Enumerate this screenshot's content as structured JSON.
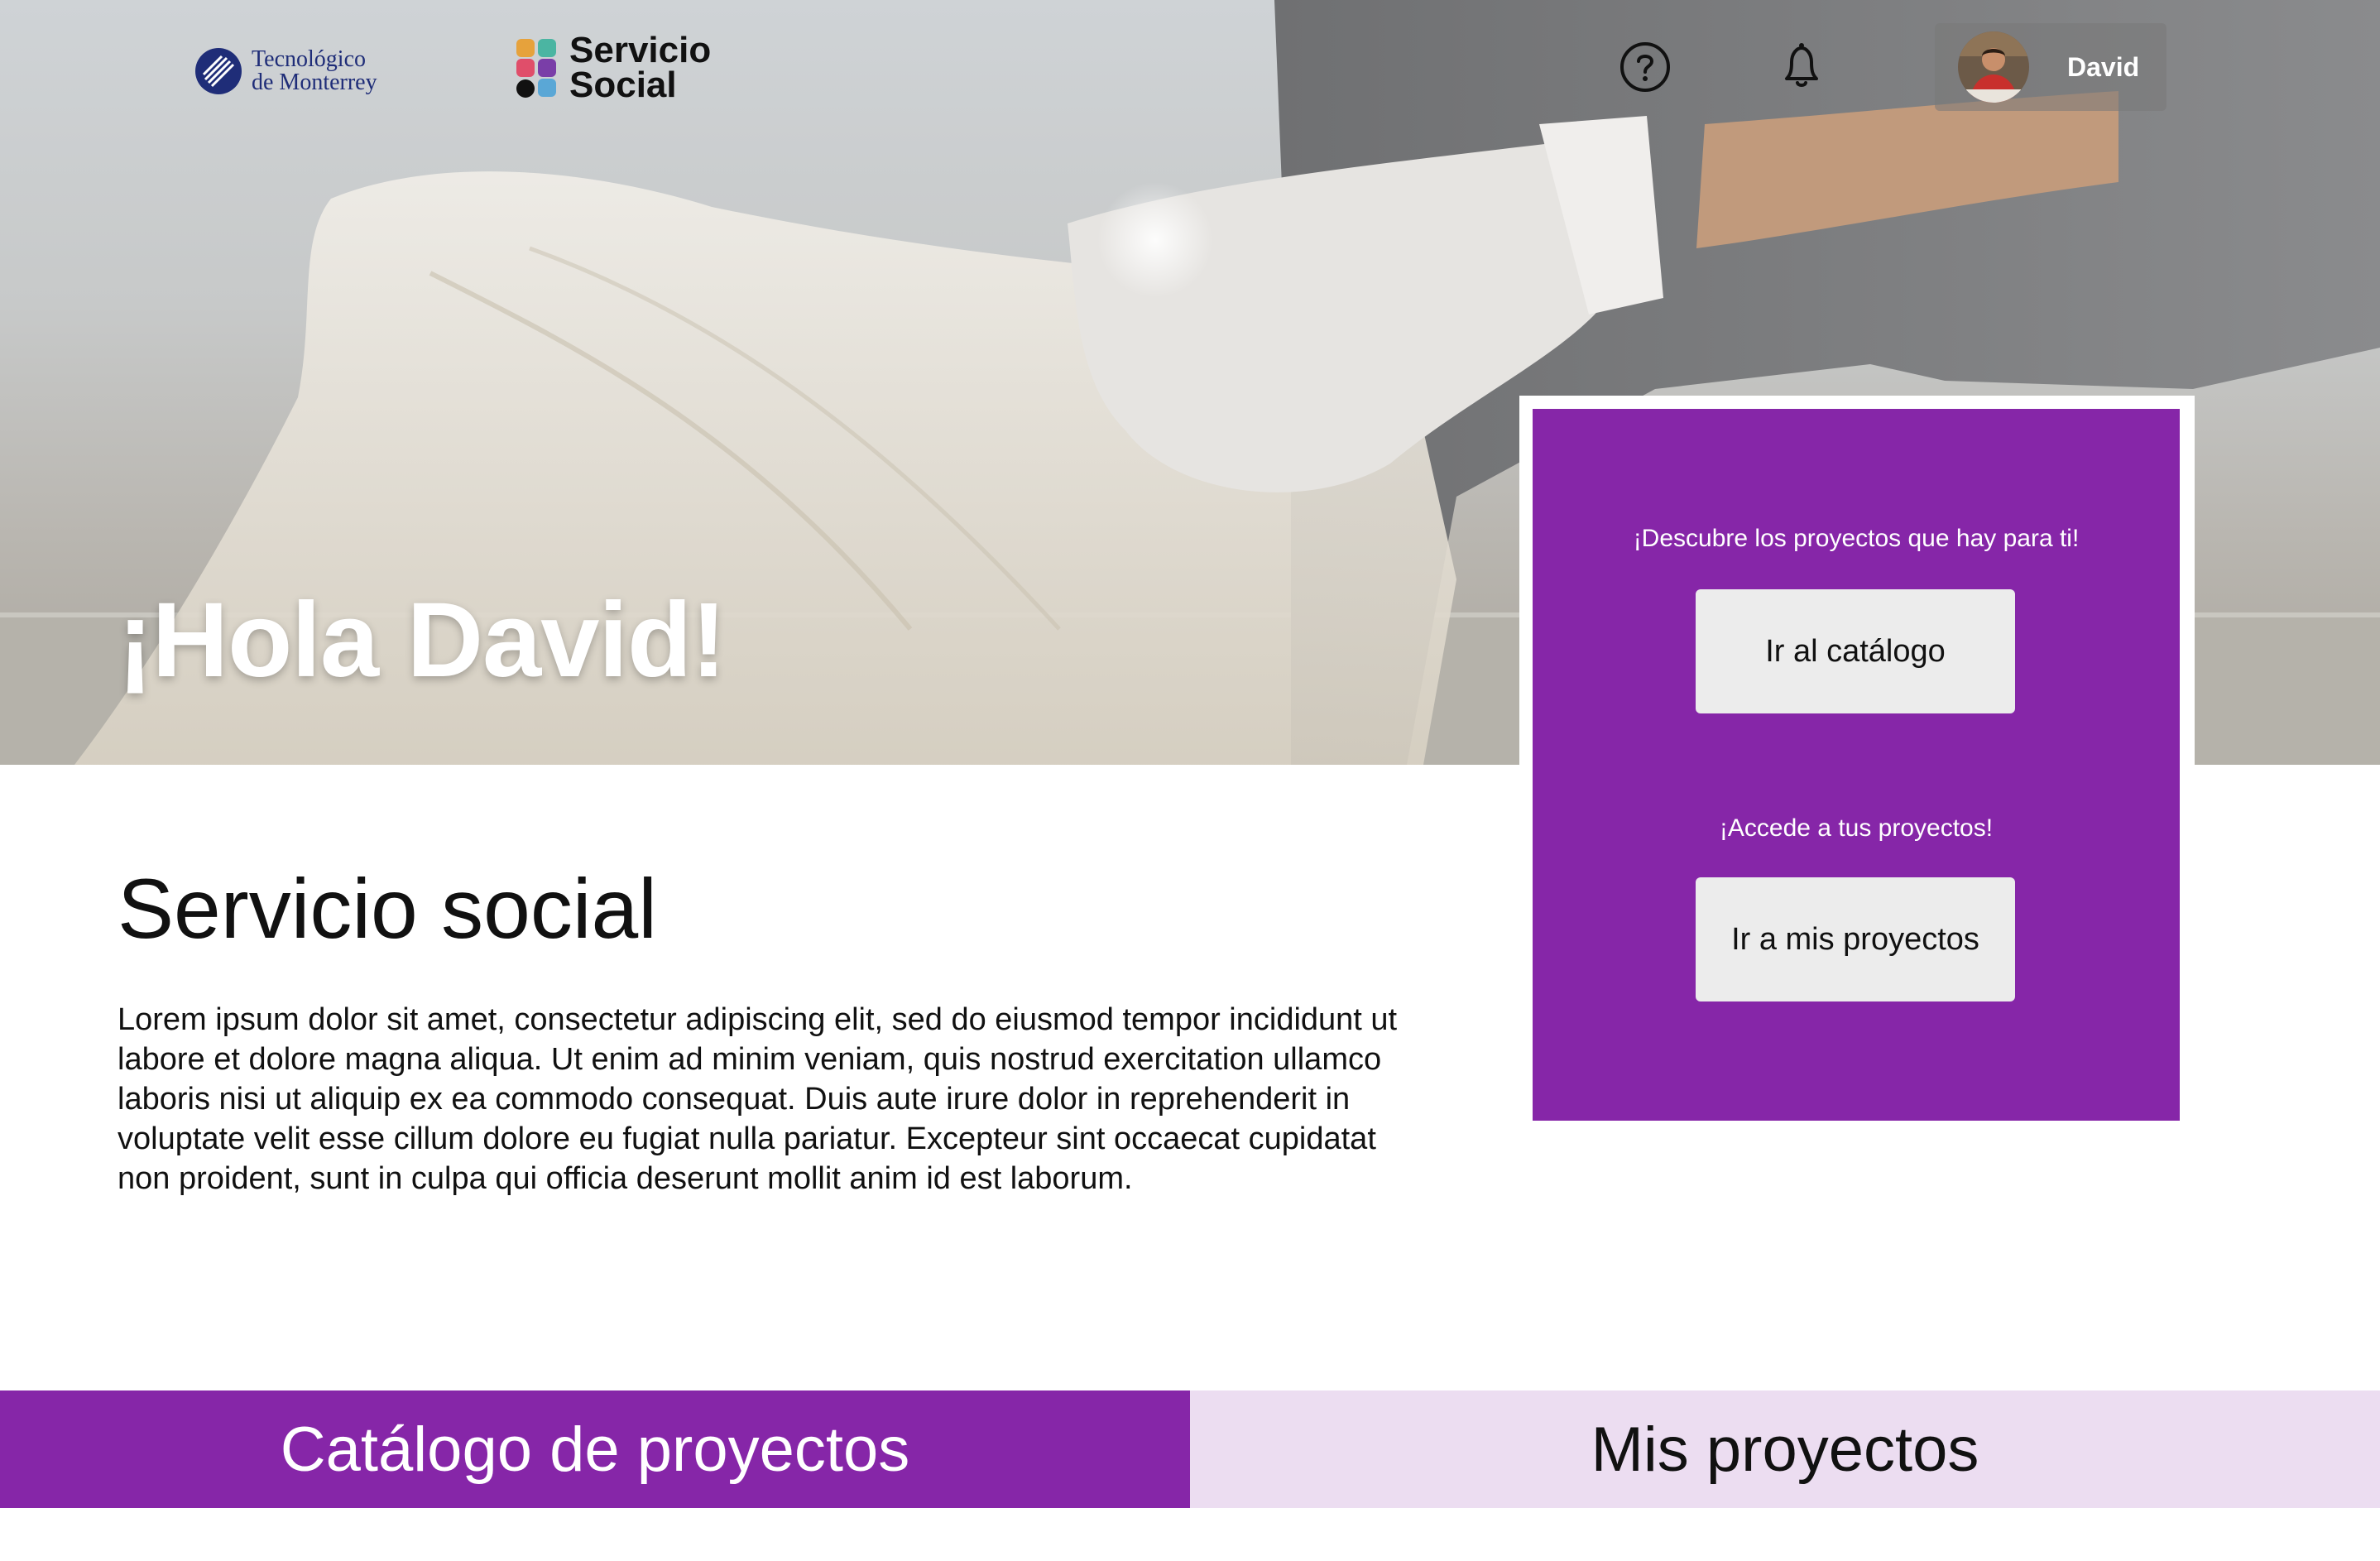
{
  "header": {
    "tec_logo": {
      "line1": "Tecnológico",
      "line2": "de Monterrey"
    },
    "servicio_logo": {
      "line1": "Servicio",
      "line2": "Social"
    },
    "help_icon": "help-circle-icon",
    "notification_icon": "bell-icon",
    "user": {
      "name": "David"
    }
  },
  "hero": {
    "greeting": "¡Hola David!"
  },
  "cta": {
    "discover_text": "¡Descubre los proyectos que hay para ti!",
    "catalog_button": "Ir al catálogo",
    "access_text": "¡Accede a tus proyectos!",
    "my_projects_button": "Ir a mis proyectos"
  },
  "section": {
    "title": "Servicio social",
    "body": "Lorem ipsum dolor sit amet, consectetur adipiscing elit, sed do eiusmod tempor incididunt ut labore et dolore magna aliqua. Ut enim ad minim veniam, quis nostrud exercitation ullamco laboris nisi ut aliquip ex ea commodo consequat. Duis aute irure dolor in reprehenderit in voluptate velit esse cillum dolore eu fugiat nulla pariatur. Excepteur sint occaecat cupidatat non proident, sunt in culpa qui officia deserunt mollit anim id est laborum."
  },
  "tabs": [
    {
      "label": "Catálogo de proyectos",
      "active": true
    },
    {
      "label": "Mis proyectos",
      "active": false
    }
  ],
  "colors": {
    "brand_purple": "#8626a8",
    "tab_inactive": "#ecddf1",
    "button_bg": "#ececec",
    "tec_blue": "#1f2d78"
  }
}
